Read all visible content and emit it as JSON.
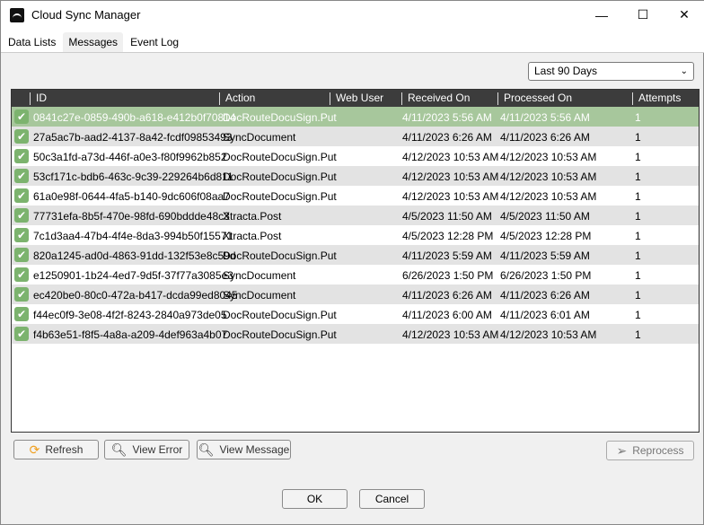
{
  "window": {
    "title": "Cloud Sync Manager",
    "minimize": "—",
    "maximize": "☐",
    "close": "✕"
  },
  "tabs": [
    {
      "label": "Data Lists"
    },
    {
      "label": "Messages",
      "active": true
    },
    {
      "label": "Event Log"
    }
  ],
  "filter": {
    "value": "Last 90 Days"
  },
  "columns": [
    "ID",
    "Action",
    "Web User",
    "Received On",
    "Processed On",
    "Attempts"
  ],
  "rows": [
    [
      "0841c27e-0859-490b-a618-e412b0f70814",
      "DocRouteDocuSign.Put",
      "",
      "4/11/2023 5:56 AM",
      "4/11/2023 5:56 AM",
      "1"
    ],
    [
      "27a5ac7b-aad2-4137-8a42-fcdf09853493",
      "SyncDocument",
      "",
      "4/11/2023 6:26 AM",
      "4/11/2023 6:26 AM",
      "1"
    ],
    [
      "50c3a1fd-a73d-446f-a0e3-f80f9962b852",
      "DocRouteDocuSign.Put",
      "",
      "4/12/2023 10:53 AM",
      "4/12/2023 10:53 AM",
      "1"
    ],
    [
      "53cf171c-bdb6-463c-9c39-229264b6d811",
      "DocRouteDocuSign.Put",
      "",
      "4/12/2023 10:53 AM",
      "4/12/2023 10:53 AM",
      "1"
    ],
    [
      "61a0e98f-0644-4fa5-b140-9dc606f08aa7",
      "DocRouteDocuSign.Put",
      "",
      "4/12/2023 10:53 AM",
      "4/12/2023 10:53 AM",
      "1"
    ],
    [
      "77731efa-8b5f-470e-98fd-690bddde48c3",
      "Xtracta.Post",
      "",
      "4/5/2023 11:50 AM",
      "4/5/2023 11:50 AM",
      "1"
    ],
    [
      "7c1d3aa4-47b4-4f4e-8da3-994b50f15571",
      "Xtracta.Post",
      "",
      "4/5/2023 12:28 PM",
      "4/5/2023 12:28 PM",
      "1"
    ],
    [
      "820a1245-ad0d-4863-91dd-132f53e8c59d",
      "DocRouteDocuSign.Put",
      "",
      "4/11/2023 5:59 AM",
      "4/11/2023 5:59 AM",
      "1"
    ],
    [
      "e1250901-1b24-4ed7-9d5f-37f77a3085e3",
      "SyncDocument",
      "",
      "6/26/2023 1:50 PM",
      "6/26/2023 1:50 PM",
      "1"
    ],
    [
      "ec420be0-80c0-472a-b417-dcda99ed8045",
      "SyncDocument",
      "",
      "4/11/2023 6:26 AM",
      "4/11/2023 6:26 AM",
      "1"
    ],
    [
      "f44ec0f9-3e08-4f2f-8243-2840a973de05",
      "DocRouteDocuSign.Put",
      "",
      "4/11/2023 6:00 AM",
      "4/11/2023 6:01 AM",
      "1"
    ],
    [
      "f4b63e51-f8f5-4a8a-a209-4def963a4b07",
      "DocRouteDocuSign.Put",
      "",
      "4/12/2023 10:53 AM",
      "4/12/2023 10:53 AM",
      "1"
    ]
  ],
  "buttons": {
    "refresh": "Refresh",
    "view_error": "View Error",
    "view_message": "View Message",
    "reprocess": "Reprocess",
    "ok": "OK",
    "cancel": "Cancel"
  },
  "colors": {
    "selected_row": "#a7c79c",
    "header": "#3c3c3c",
    "check": "#7cb36e"
  }
}
